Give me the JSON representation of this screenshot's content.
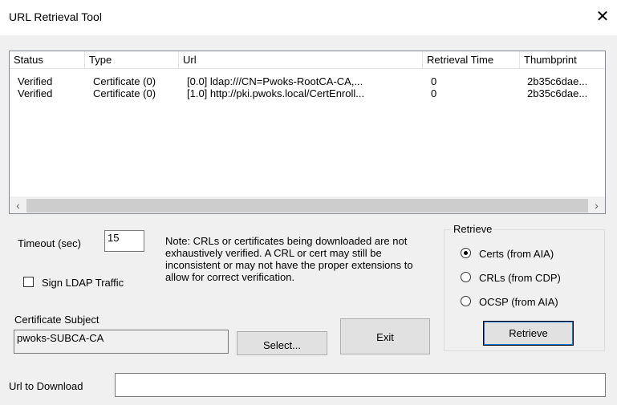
{
  "window": {
    "title": "URL Retrieval Tool",
    "close_glyph": "✕"
  },
  "list": {
    "columns": [
      "Status",
      "Type",
      "Url",
      "Retrieval Time",
      "Thumbprint"
    ],
    "rows": [
      [
        "Verified",
        "Certificate (0)",
        "[0.0] ldap:///CN=Pwoks-RootCA-CA,...",
        "0",
        "2b35c6dae..."
      ],
      [
        "Verified",
        "Certificate (0)",
        "[1.0] http://pki.pwoks.local/CertEnroll...",
        "0",
        "2b35c6dae..."
      ]
    ],
    "scroll_left": "‹",
    "scroll_right": "›"
  },
  "timeout": {
    "label": "Timeout (sec)",
    "value": "15"
  },
  "sign_ldap": {
    "label": "Sign LDAP Traffic",
    "checked": false
  },
  "note": "Note: CRLs or certificates being downloaded are not exhaustively verified.  A CRL or cert may still be inconsistent or may not have the proper extensions to allow for correct verification.",
  "cert_subject": {
    "label": "Certificate Subject",
    "value": "pwoks-SUBCA-CA"
  },
  "buttons": {
    "select": "Select...",
    "exit": "Exit",
    "retrieve": "Retrieve"
  },
  "retrieve_group": {
    "legend": "Retrieve",
    "options": [
      "Certs (from AIA)",
      "CRLs (from CDP)",
      "OCSP (from AIA)"
    ],
    "selected": "Certs (from AIA)"
  },
  "url_download": {
    "label": "Url to Download",
    "value": ""
  }
}
